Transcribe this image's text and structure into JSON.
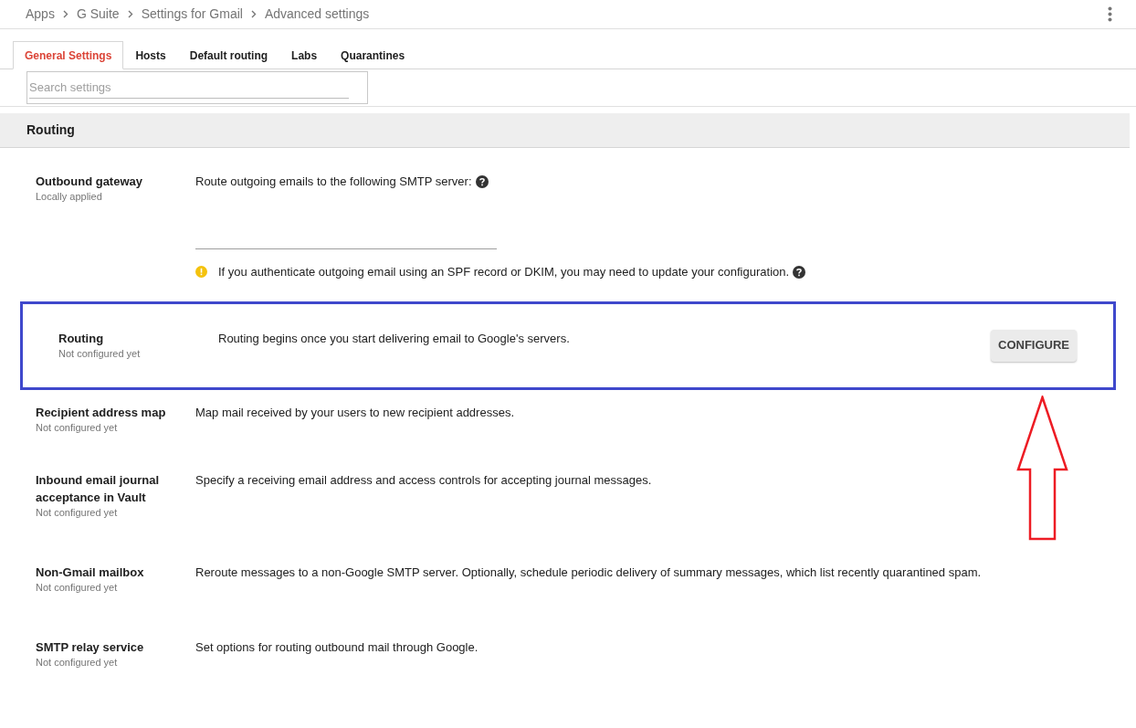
{
  "breadcrumb": [
    "Apps",
    "G Suite",
    "Settings for Gmail",
    "Advanced settings"
  ],
  "tabs": [
    {
      "label": "General Settings",
      "selected": true
    },
    {
      "label": "Hosts",
      "selected": false
    },
    {
      "label": "Default routing",
      "selected": false
    },
    {
      "label": "Labs",
      "selected": false
    },
    {
      "label": "Quarantines",
      "selected": false
    }
  ],
  "search": {
    "placeholder": "Search settings"
  },
  "section": {
    "title": "Routing"
  },
  "settings": [
    {
      "kind": "gateway",
      "title": "Outbound gateway",
      "status": "Locally applied",
      "description": "Route outgoing emails to the following SMTP server:",
      "note": "If you authenticate outgoing email using an SPF record or DKIM, you may need to update your configuration.",
      "highlighted": false
    },
    {
      "kind": "button",
      "title": "Routing",
      "status": "Not configured yet",
      "description": "Routing begins once you start delivering email to Google's servers.",
      "button": "CONFIGURE",
      "highlighted": true
    },
    {
      "kind": "plain",
      "title": "Recipient address map",
      "status": "Not configured yet",
      "description": "Map mail received by your users to new recipient addresses.",
      "highlighted": false
    },
    {
      "kind": "plain",
      "title": "Inbound email journal acceptance in Vault",
      "status": "Not configured yet",
      "description": "Specify a receiving email address and access controls for accepting journal messages.",
      "highlighted": false
    },
    {
      "kind": "plain",
      "title": "Non-Gmail mailbox",
      "status": "Not configured yet",
      "description": "Reroute messages to a non-Google SMTP server. Optionally, schedule periodic delivery of summary messages, which list recently quarantined spam.",
      "highlighted": false
    },
    {
      "kind": "plain",
      "title": "SMTP relay service",
      "status": "Not configured yet",
      "description": "Set options for routing outbound mail through Google.",
      "highlighted": false
    }
  ]
}
